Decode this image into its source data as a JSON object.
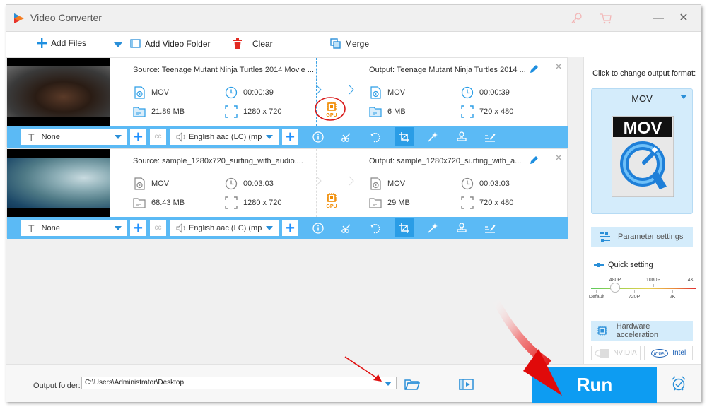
{
  "window": {
    "title": "Video Converter",
    "titlebar_icons": [
      "key-icon",
      "cart-icon"
    ],
    "minimize_label": "—",
    "close_label": "✕"
  },
  "toolbar": {
    "add_files": "Add Files",
    "add_video_folder": "Add Video Folder",
    "clear": "Clear",
    "merge": "Merge"
  },
  "files": [
    {
      "source": {
        "title": "Source: Teenage Mutant Ninja Turtles 2014 Movie ...",
        "format": "MOV",
        "duration": "00:00:39",
        "size": "21.89 MB",
        "resolution": "1280 x 720"
      },
      "gpu_label": "GPU",
      "output": {
        "title": "Output: Teenage Mutant Ninja Turtles 2014 ...",
        "format": "MOV",
        "duration": "00:00:39",
        "size": "6 MB",
        "resolution": "720 x 480"
      },
      "subtitle": "None",
      "audio": "English aac (LC) (mp",
      "close_label": "✕"
    },
    {
      "source": {
        "title": "Source: sample_1280x720_surfing_with_audio....",
        "format": "MOV",
        "duration": "00:03:03",
        "size": "68.43 MB",
        "resolution": "1280 x 720"
      },
      "gpu_label": "GPU",
      "output": {
        "title": "Output: sample_1280x720_surfing_with_a...",
        "format": "MOV",
        "duration": "00:03:03",
        "size": "29 MB",
        "resolution": "720 x 480"
      },
      "subtitle": "None",
      "audio": "English aac (LC) (mp",
      "close_label": "✕"
    }
  ],
  "edit_tools": [
    "info-icon",
    "cut-icon",
    "rotate-icon",
    "crop-icon",
    "effects-icon",
    "watermark-icon",
    "subtitle-edit-icon"
  ],
  "right_panel": {
    "format_prompt": "Click to change output format:",
    "format": "MOV",
    "format_icon_text": "MOV",
    "parameter_settings": "Parameter settings",
    "quick_setting": "Quick setting",
    "quality_ticks_top": [
      "480P",
      "1080P",
      "4K"
    ],
    "quality_ticks_bottom": [
      "Default",
      "720P",
      "2K"
    ],
    "quality_selected": "480P",
    "hardware_acceleration": "Hardware acceleration",
    "nvidia": "NVIDIA",
    "intel": "Intel",
    "intel_logo": "intel"
  },
  "bottom": {
    "output_folder_label": "Output folder:",
    "output_folder_value": "C:\\Users\\Administrator\\Desktop",
    "run": "Run"
  },
  "colors": {
    "accent": "#0d9cf2",
    "toolbar_blue": "#5bbaf5",
    "panel_blue": "#d4ecfb",
    "gpu_orange": "#f08a00",
    "annotation_red": "#e01010"
  }
}
